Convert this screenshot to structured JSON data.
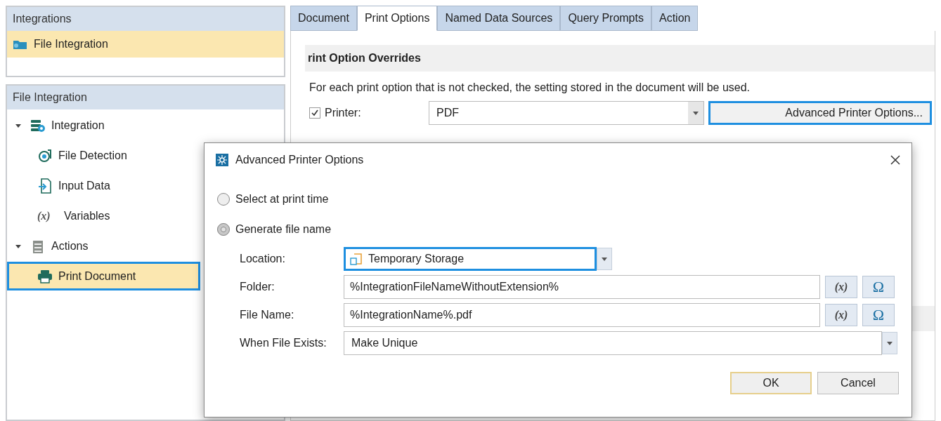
{
  "sidebar": {
    "integrations_panel": {
      "title": "Integrations",
      "items": [
        {
          "label": "File Integration",
          "selected": true
        }
      ]
    },
    "tree_panel": {
      "title": "File Integration",
      "items": [
        {
          "label": "Integration",
          "kind": "integration",
          "expanded": true,
          "selected": false,
          "children": [
            {
              "label": "File Detection",
              "kind": "detection",
              "selected": false
            },
            {
              "label": "Input Data",
              "kind": "input",
              "selected": false
            },
            {
              "label": "Variables",
              "glyph": "(x)",
              "selected": false
            }
          ]
        },
        {
          "label": "Actions",
          "kind": "actions",
          "expanded": true,
          "selected": false,
          "children": [
            {
              "label": "Print Document",
              "kind": "printer",
              "selected": true
            }
          ]
        }
      ]
    }
  },
  "tabs": [
    {
      "label": "Document",
      "selected": false
    },
    {
      "label": "Print Options",
      "selected": true
    },
    {
      "label": "Named Data Sources",
      "selected": false
    },
    {
      "label": "Query Prompts",
      "selected": false
    },
    {
      "label": "Action",
      "selected": false
    }
  ],
  "print_options": {
    "heading": "rint Option Overrides",
    "note": "For each print option that is not checked, the setting stored in the document will be used.",
    "printer": {
      "label": "Printer:",
      "checked": true,
      "value": "PDF"
    },
    "advanced_button": {
      "label": "Advanced Printer Options...",
      "focused": true
    }
  },
  "dialog": {
    "title": "Advanced Printer Options",
    "options": [
      {
        "label": "Select at print time",
        "selected": false
      },
      {
        "label": "Generate file name",
        "selected": true
      }
    ],
    "fields": [
      {
        "kind": "dropdown",
        "label": "Location:",
        "value": "Temporary Storage",
        "focused": true,
        "wide": false
      },
      {
        "kind": "text",
        "label": "Folder:",
        "value": "%IntegrationFileNameWithoutExtension%",
        "buttons": [
          "(x)",
          "Ω"
        ]
      },
      {
        "kind": "text",
        "label": "File Name:",
        "value": "%IntegrationName%.pdf",
        "buttons": [
          "(x)",
          "Ω"
        ]
      },
      {
        "kind": "dropdown",
        "label": "When File Exists:",
        "value": "Make Unique",
        "focused": false,
        "wide": true
      }
    ],
    "buttons": [
      {
        "label": "OK",
        "default": true
      },
      {
        "label": "Cancel",
        "default": false
      }
    ]
  }
}
